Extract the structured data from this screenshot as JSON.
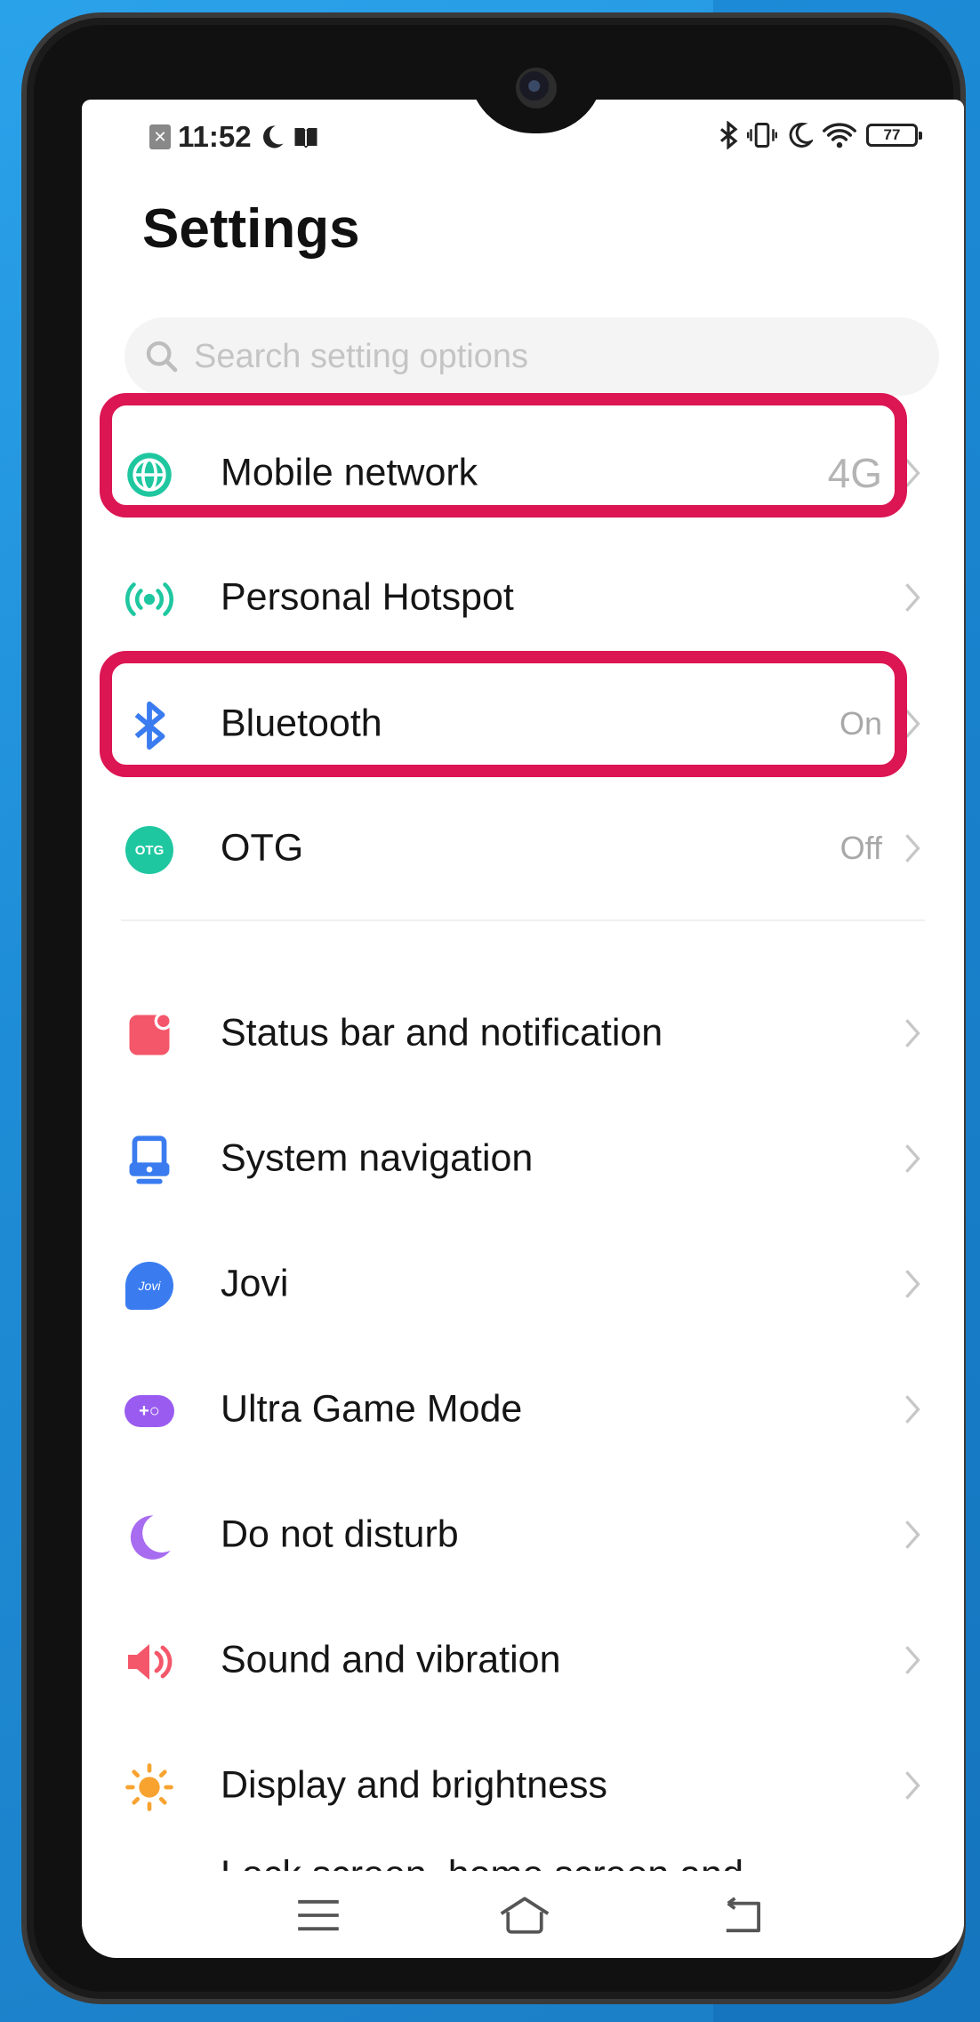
{
  "status_bar": {
    "time": "11:52",
    "battery": "77",
    "left_icons": [
      "notification-x-icon",
      "moon-icon",
      "book-icon"
    ],
    "right_icons": [
      "bluetooth-icon",
      "vibrate-icon",
      "moon-icon",
      "wifi-icon",
      "battery-icon"
    ]
  },
  "page": {
    "title": "Settings"
  },
  "search": {
    "placeholder": "Search setting options"
  },
  "settings": [
    {
      "label": "Mobile network",
      "value": "4G",
      "icon": "globe-icon",
      "color": "#1fc7a0"
    },
    {
      "label": "Personal Hotspot",
      "value": "",
      "icon": "hotspot-icon",
      "color": "#1fc7a0"
    },
    {
      "label": "Bluetooth",
      "value": "On",
      "icon": "bluetooth-icon",
      "color": "#3a7cf0"
    },
    {
      "label": "OTG",
      "value": "Off",
      "icon": "otg-icon",
      "icon_text": "OTG",
      "color": "#1fc7a0"
    },
    {
      "label": "Status bar and notification",
      "value": "",
      "icon": "notification-badge-icon",
      "color": "#f4576a"
    },
    {
      "label": "System navigation",
      "value": "",
      "icon": "system-navigation-icon",
      "color": "#3a7cf0"
    },
    {
      "label": "Jovi",
      "value": "",
      "icon": "jovi-icon",
      "icon_text": "Jovi",
      "color": "#3a7cf0"
    },
    {
      "label": "Ultra Game Mode",
      "value": "",
      "icon": "gamepad-icon",
      "icon_text": "+○",
      "color": "#9a5cf0"
    },
    {
      "label": "Do not disturb",
      "value": "",
      "icon": "moon-icon",
      "color": "#a86cf0"
    },
    {
      "label": "Sound and vibration",
      "value": "",
      "icon": "speaker-icon",
      "color": "#f4576a"
    },
    {
      "label": "Display and brightness",
      "value": "",
      "icon": "sun-icon",
      "color": "#f8a330"
    }
  ],
  "cutoff_row": {
    "label": "Lock screen, home screen and"
  },
  "highlight_color": "#dc1553",
  "navigation": {
    "buttons": [
      "menu-icon",
      "home-icon",
      "back-icon"
    ]
  }
}
